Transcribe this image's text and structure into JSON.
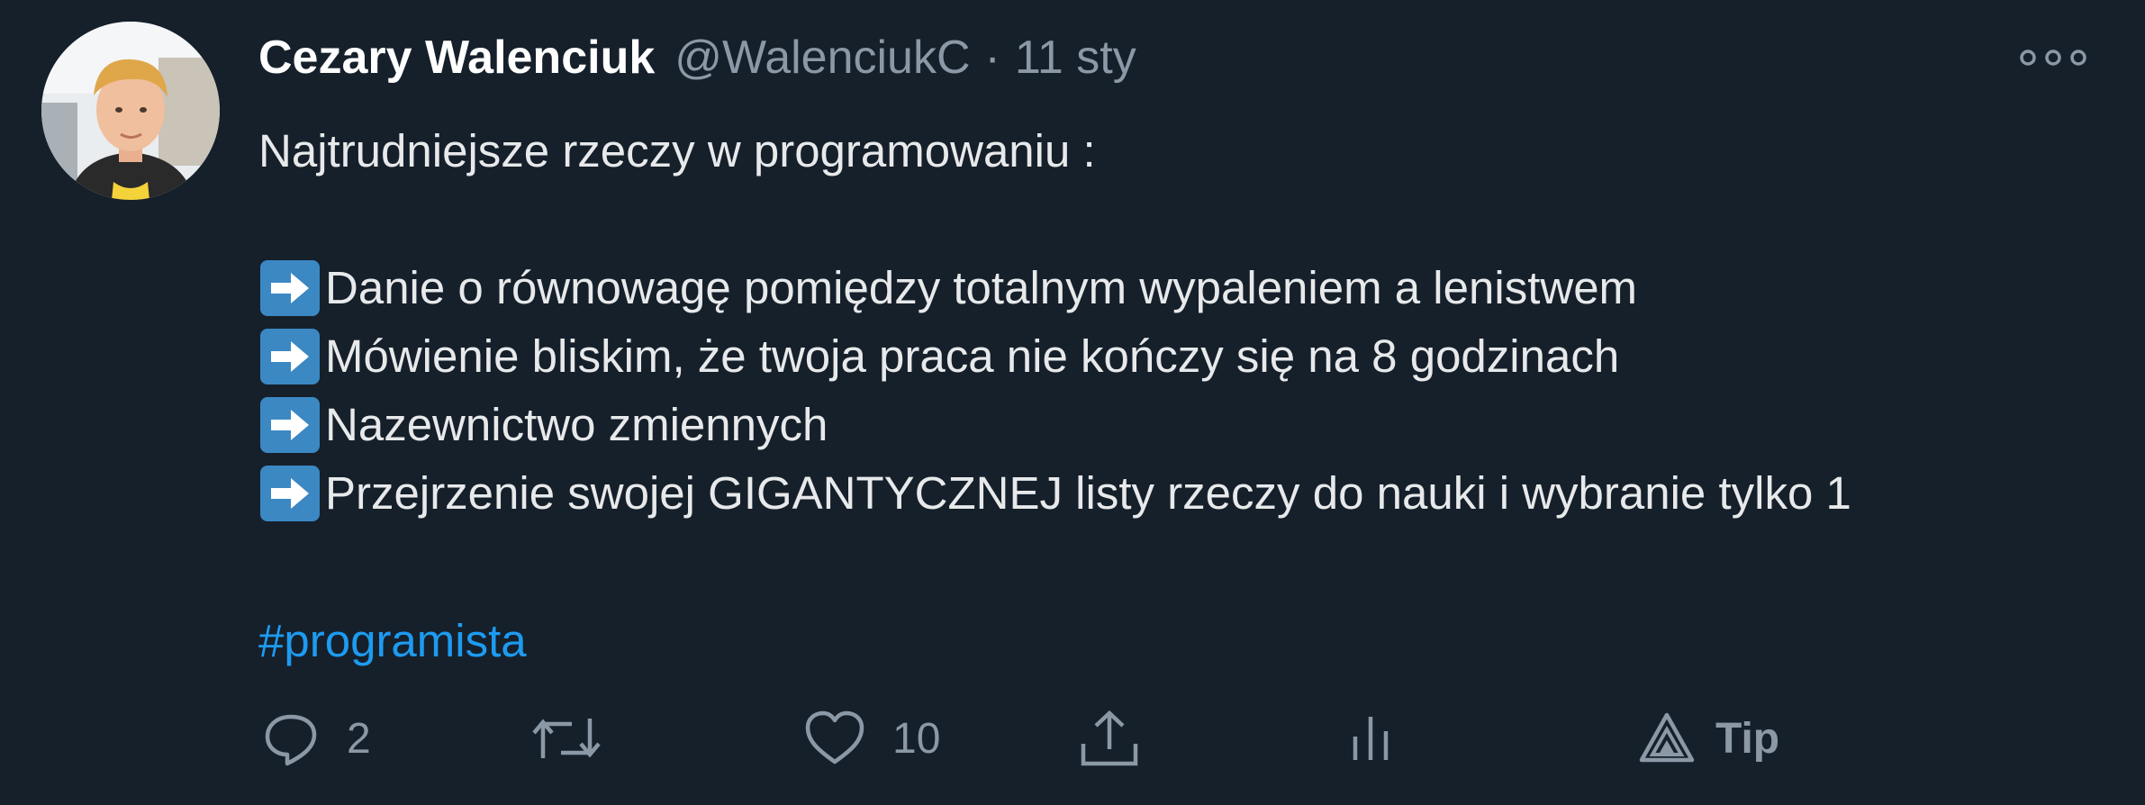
{
  "tweet": {
    "author_name": "Cezary Walenciuk",
    "handle": "@WalenciukC",
    "separator": "·",
    "date": "11 sty",
    "intro": "Najtrudniejsze rzeczy w programowaniu :",
    "items": [
      "Danie o równowagę pomiędzy totalnym wypaleniem a lenistwem",
      "Mówienie bliskim, że twoja praca nie kończy się na 8 godzinach",
      "Nazewnictwo zmiennych",
      "Przejrzenie swojej GIGANTYCZNEJ listy rzeczy do nauki i wybranie tylko 1"
    ],
    "hashtag": "#programista"
  },
  "actions": {
    "reply_count": "2",
    "retweet_count": "",
    "like_count": "10",
    "tip_label": "Tip"
  },
  "icons": {
    "avatar": "avatar-photo",
    "more": "more-options-icon",
    "bullet": "right-arrow-emoji",
    "reply": "reply-icon",
    "retweet": "retweet-icon",
    "like": "heart-icon",
    "share": "share-icon",
    "analytics": "analytics-icon",
    "tip": "tip-icon"
  },
  "colors": {
    "background": "#16202b",
    "text": "#e7e9ea",
    "muted": "#8b98a5",
    "link": "#1d9bf0",
    "emoji_blue": "#3b88c3"
  }
}
